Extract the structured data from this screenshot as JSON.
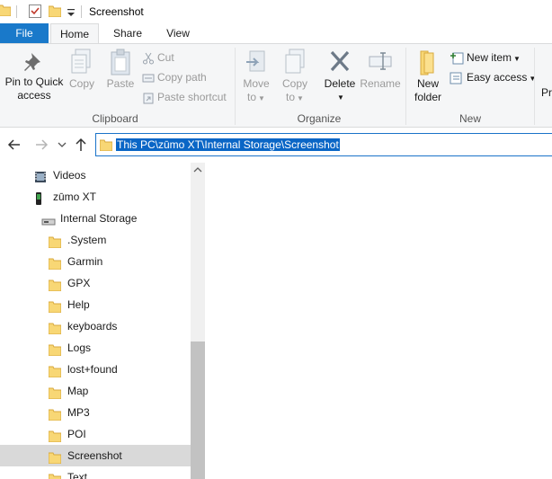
{
  "window": {
    "title": "Screenshot"
  },
  "tabs": {
    "file": "File",
    "home": "Home",
    "share": "Share",
    "view": "View"
  },
  "ribbon": {
    "clipboard": {
      "group_label": "Clipboard",
      "pin_line1": "Pin to Quick",
      "pin_line2": "access",
      "copy": "Copy",
      "paste": "Paste",
      "cut": "Cut",
      "copy_path": "Copy path",
      "paste_shortcut": "Paste shortcut"
    },
    "organize": {
      "group_label": "Organize",
      "move_to_line1": "Move",
      "move_to_line2": "to",
      "copy_to_line1": "Copy",
      "copy_to_line2": "to",
      "delete": "Delete",
      "rename": "Rename"
    },
    "new": {
      "group_label": "New",
      "new_folder_line1": "New",
      "new_folder_line2": "folder",
      "new_item": "New item",
      "easy_access": "Easy access"
    },
    "next_group_partial": "Pr"
  },
  "address": {
    "path": "This PC\\zūmo XT\\Internal Storage\\Screenshot"
  },
  "tree": [
    {
      "label": "Videos",
      "icon": "videos-icon",
      "indent": 1
    },
    {
      "label": "zūmo XT",
      "icon": "device-icon",
      "indent": 1
    },
    {
      "label": "Internal Storage",
      "icon": "drive-icon",
      "indent": 2
    },
    {
      "label": ".System",
      "icon": "folder-icon",
      "indent": 3
    },
    {
      "label": "Garmin",
      "icon": "folder-icon",
      "indent": 3
    },
    {
      "label": "GPX",
      "icon": "folder-icon",
      "indent": 3
    },
    {
      "label": "Help",
      "icon": "folder-icon",
      "indent": 3
    },
    {
      "label": "keyboards",
      "icon": "folder-icon",
      "indent": 3
    },
    {
      "label": "Logs",
      "icon": "folder-icon",
      "indent": 3
    },
    {
      "label": "lost+found",
      "icon": "folder-icon",
      "indent": 3
    },
    {
      "label": "Map",
      "icon": "folder-icon",
      "indent": 3
    },
    {
      "label": "MP3",
      "icon": "folder-icon",
      "indent": 3
    },
    {
      "label": "POI",
      "icon": "folder-icon",
      "indent": 3
    },
    {
      "label": "Screenshot",
      "icon": "folder-icon",
      "indent": 3,
      "selected": true
    },
    {
      "label": "Text",
      "icon": "folder-icon",
      "indent": 3
    }
  ],
  "colors": {
    "accent": "#1979ca",
    "selection": "#d9d9d9",
    "folder": "#ffd966"
  }
}
